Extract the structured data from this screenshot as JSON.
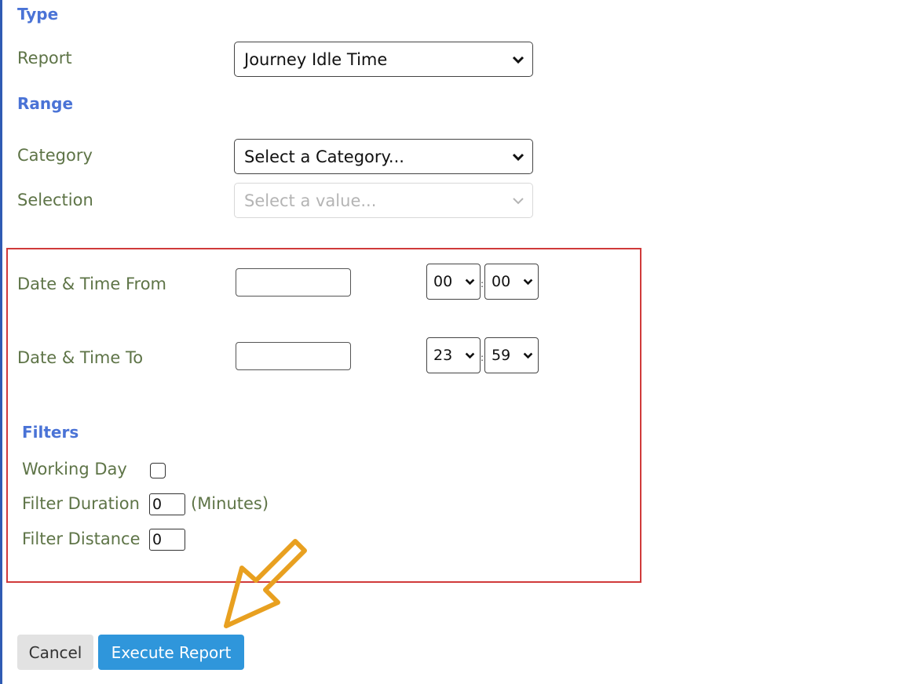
{
  "type_section": {
    "heading": "Type",
    "report_label": "Report",
    "report_value": "Journey Idle Time"
  },
  "range_section": {
    "heading": "Range",
    "category_label": "Category",
    "category_value": "Select a Category...",
    "selection_label": "Selection",
    "selection_placeholder": "Select a value..."
  },
  "date_from": {
    "label": "Date & Time From",
    "date_value": "",
    "hour": "00",
    "minute": "00"
  },
  "date_to": {
    "label": "Date & Time To",
    "date_value": "",
    "hour": "23",
    "minute": "59"
  },
  "time_separator": ":",
  "filters": {
    "heading": "Filters",
    "working_day_label": "Working Day",
    "working_day_checked": false,
    "duration_label": "Filter Duration",
    "duration_value": "0",
    "duration_unit": "(Minutes)",
    "distance_label": "Filter Distance",
    "distance_value": "0"
  },
  "actions": {
    "cancel_label": "Cancel",
    "execute_label": "Execute Report"
  },
  "icons": {
    "dropdown": "chevron-down-icon",
    "annotation_arrow": "arrow-pointer-icon"
  },
  "colors": {
    "heading": "#4a73d6",
    "label": "#5e7447",
    "highlight_border": "#d03a3a",
    "execute_button": "#2f96db",
    "cancel_button": "#e2e2e2",
    "annotation_arrow": "#e8a020"
  }
}
